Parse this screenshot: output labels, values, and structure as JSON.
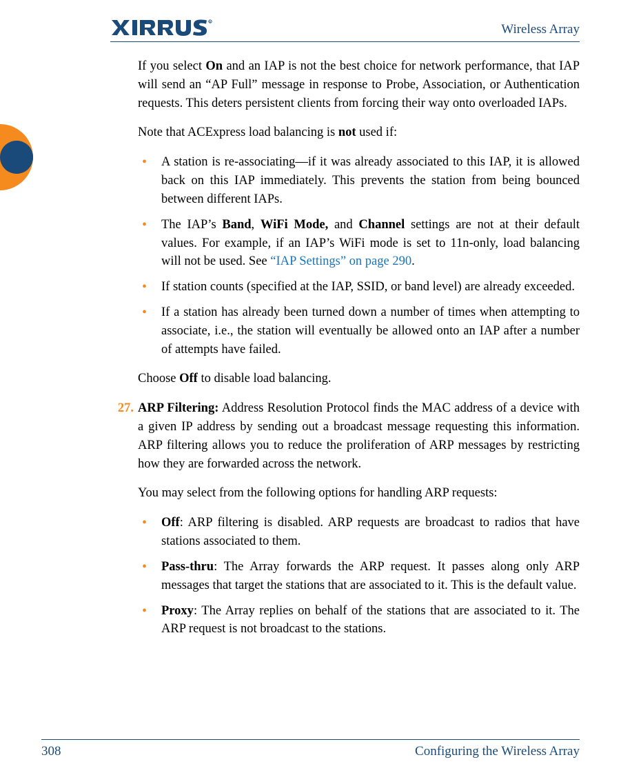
{
  "header": {
    "doc_title": "Wireless Array"
  },
  "intro": {
    "p1_pre": "If you select ",
    "p1_on": "On",
    "p1_post": " and an IAP is not the best choice for network performance, that IAP will send an “AP Full” message in response to Probe, Association, or Authentication requests. This deters persistent clients from forcing their way onto overloaded IAPs.",
    "p2_pre": "Note that ACExpress load balancing is ",
    "p2_not": "not",
    "p2_post": " used if:"
  },
  "bullets1": {
    "b1": "A station is re-associating—if it was already associated to this IAP, it is allowed back on this IAP immediately. This prevents the station from being bounced between different IAPs.",
    "b2_pre": "The IAP’s ",
    "b2_band": "Band",
    "b2_c1": ", ",
    "b2_wifi": "WiFi Mode,",
    "b2_c2": " and ",
    "b2_channel": "Channel",
    "b2_mid": " settings are not at their default values. For example, if an IAP’s WiFi mode is set to 11n-only, load balancing will not be used. See ",
    "b2_link": "“IAP Settings” on page 290",
    "b2_end": ".",
    "b3": "If station counts (specified at the IAP, SSID, or band level) are already exceeded.",
    "b4": "If a station has already been turned down a number of times when attempting to associate, i.e., the station will eventually be allowed onto an IAP after a number of attempts have failed."
  },
  "off_line": {
    "pre": "Choose ",
    "off": "Off",
    "post": " to disable load balancing."
  },
  "item27": {
    "num": "27.",
    "title": "ARP Filtering:",
    "desc": " Address Resolution Protocol finds the MAC address of a device with a given IP address by sending out a broadcast message requesting this information. ARP filtering allows you to reduce the proliferation of ARP messages by restricting how they are forwarded across the network.",
    "lead": "You may select from the following options for handling ARP requests:",
    "opts": {
      "off_label": "Off",
      "off_text": ": ARP filtering is disabled. ARP requests are broadcast to radios that have stations associated to them.",
      "pass_label": "Pass-thru",
      "pass_text": ": The Array forwards the ARP request. It passes along only ARP messages that target the stations that are associated to it. This is the default value.",
      "proxy_label": "Proxy",
      "proxy_text": ": The Array replies on behalf of the stations that are associated to it. The ARP request is not broadcast to the stations."
    }
  },
  "footer": {
    "page": "308",
    "section": "Configuring the Wireless Array"
  }
}
